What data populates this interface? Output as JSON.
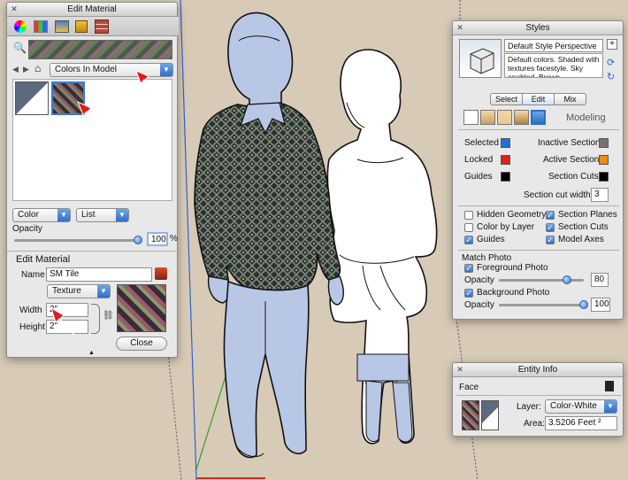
{
  "edit_material": {
    "title": "Edit Material",
    "library_select": "Colors In Model",
    "color_mode": "Color",
    "view_mode": "List",
    "opacity_label": "Opacity",
    "opacity_value": "100",
    "opacity_unit": "%",
    "opacity_fraction": 1.0,
    "section_title": "Edit Material",
    "name_label": "Name",
    "name_value": "SM Tile",
    "texture_select": "Texture",
    "width_label": "Width",
    "width_value": "2\"",
    "height_label": "Height",
    "height_value": "2\"",
    "close_label": "Close"
  },
  "styles": {
    "title": "Styles",
    "style_name": "Default Style Perspective View",
    "description": "Default colors.  Shaded with textures facestyle.  Sky enabled.  Brown background.",
    "tabs": [
      "Select",
      "Edit",
      "Mix"
    ],
    "active_tab": "Edit",
    "section_name": "Modeling",
    "colors": {
      "selected_label": "Selected",
      "selected_color": "#1f6fe0",
      "locked_label": "Locked",
      "locked_color": "#e0201b",
      "guides_label": "Guides",
      "guides_color": "#000000",
      "inactive_section_label": "Inactive Section",
      "inactive_section_color": "#7b7373",
      "active_section_label": "Active Section",
      "active_section_color": "#f08a10",
      "section_cuts_label": "Section Cuts",
      "section_cuts_color": "#000000"
    },
    "section_cut_width_label": "Section cut width",
    "section_cut_width_value": "3",
    "checks": {
      "hidden_geometry": "Hidden Geometry",
      "color_by_layer": "Color by Layer",
      "guides": "Guides",
      "section_planes": "Section Planes",
      "section_cuts": "Section Cuts",
      "model_axes": "Model Axes"
    },
    "match_photo_title": "Match Photo",
    "foreground_photo_label": "Foreground Photo",
    "fg_opacity_label": "Opacity",
    "fg_opacity_value": "80",
    "fg_opacity_fraction": 0.8,
    "background_photo_label": "Background Photo",
    "bg_opacity_label": "Opacity",
    "bg_opacity_value": "100",
    "bg_opacity_fraction": 1.0
  },
  "entity_info": {
    "title": "Entity Info",
    "entity_type": "Face",
    "layer_label": "Layer:",
    "layer_value": "Color-White",
    "area_label": "Area:",
    "area_value": "3.5206 Feet ²"
  },
  "colors": {
    "viewport_bg": "#d7cab6",
    "figure_fill": "#b9c7e6",
    "figure_stroke": "#111111",
    "accent_blue": "#3a7bd5",
    "annotation_red": "#e21b1b"
  }
}
